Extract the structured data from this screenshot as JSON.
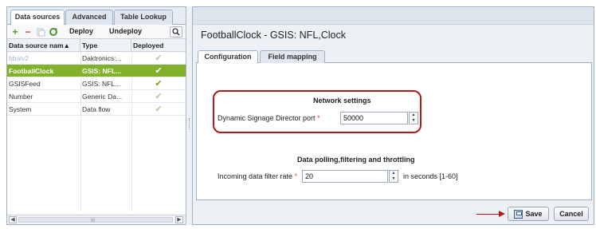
{
  "left_tabs": [
    {
      "label": "Data sources",
      "active": true
    },
    {
      "label": "Advanced",
      "active": false
    },
    {
      "label": "Table Lookup",
      "active": false
    }
  ],
  "toolbar": {
    "deploy_label": "Deploy",
    "undeploy_label": "Undeploy",
    "icons": [
      "add-icon",
      "remove-icon",
      "copy-icon",
      "refresh-icon",
      "search-icon"
    ],
    "colors": {
      "add": "#5a9a1a",
      "remove": "#d23b3b",
      "copy": "#b7c2cf",
      "refresh": "#4c9a2a"
    }
  },
  "grid": {
    "columns": [
      "Data source nam▲",
      "Type",
      "Deployed"
    ],
    "rows": [
      {
        "name": "bbalv2",
        "type": "Daktronics:...",
        "deployed": "✔",
        "selected": false,
        "muted": true
      },
      {
        "name": "FootballClock",
        "type": "GSIS: NFL...",
        "deployed": "✔",
        "selected": true,
        "muted": false
      },
      {
        "name": "GSISFeed",
        "type": "GSIS: NFL...",
        "deployed": "✔",
        "selected": false,
        "muted": false,
        "strong": true
      },
      {
        "name": "Number",
        "type": "Generic Da...",
        "deployed": "✔",
        "selected": false,
        "muted": false
      },
      {
        "name": "System",
        "type": "Data flow",
        "deployed": "✔",
        "selected": false,
        "muted": false
      }
    ],
    "scroll_grip": "III"
  },
  "detail": {
    "title": "FootballClock - GSIS: NFL,Clock",
    "tabs": [
      {
        "label": "Configuration",
        "active": true
      },
      {
        "label": "Field mapping",
        "active": false
      }
    ],
    "network": {
      "heading": "Network settings",
      "port_label": "Dynamic Signage Director port",
      "required_mark": "*",
      "port_value": "50000"
    },
    "polling": {
      "heading": "Data polling,filtering and throttling",
      "rate_label": "Incoming data filter rate",
      "required_mark": "*",
      "rate_value": "20",
      "hint": "in seconds [1-60]"
    },
    "save_label": "Save",
    "cancel_label": "Cancel",
    "highlight_color": "#b11a1a",
    "accent_color": "#84b12b"
  }
}
